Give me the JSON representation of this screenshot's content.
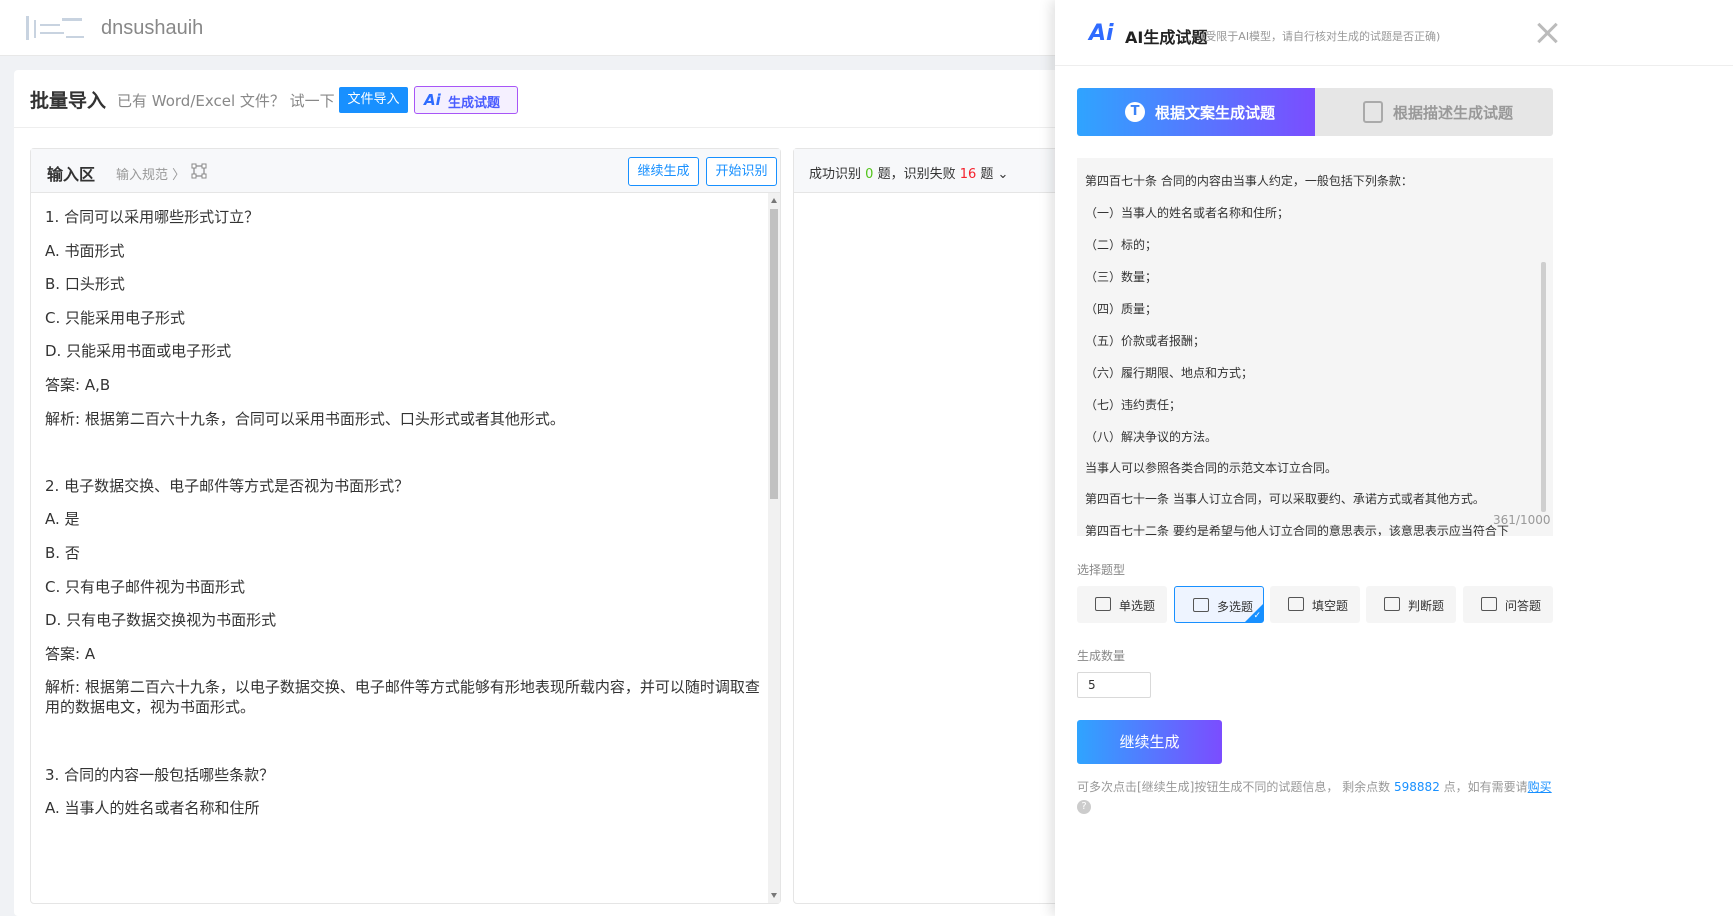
{
  "topbar": {
    "site_name": "dnsushauih"
  },
  "header": {
    "title": "批量导入",
    "desc": "已有 Word/Excel 文件？ 试一下",
    "file_import": "文件导入",
    "ai_mark": "Ai",
    "ai_generate": "生成试题"
  },
  "input_area": {
    "title": "输入区",
    "spec": "输入规范 〉",
    "continue": "继续生成",
    "start": "开始识别",
    "lines": [
      "1. 合同可以采用哪些形式订立？",
      "A. 书面形式",
      "B. 口头形式",
      "C. 只能采用电子形式",
      "D. 只能采用书面或电子形式",
      "答案: A,B",
      "解析: 根据第二百六十九条，合同可以采用书面形式、口头形式或者其他形式。",
      "",
      "2. 电子数据交换、电子邮件等方式是否视为书面形式？",
      "A. 是",
      "B. 否",
      "C. 只有电子邮件视为书面形式",
      "D. 只有电子数据交换视为书面形式",
      "答案: A",
      "解析: 根据第二百六十九条，以电子数据交换、电子邮件等方式能够有形地表现所载内容，并可以随时调取查用的数据电文，视为书面形式。",
      "",
      "3. 合同的内容一般包括哪些条款？",
      "A. 当事人的姓名或者名称和住所"
    ]
  },
  "result": {
    "prefix": "成功识别",
    "success": "0",
    "mid": "题，识别失败",
    "fail": "16",
    "suffix": "题 ⌄"
  },
  "drawer": {
    "icon": "Ai",
    "title": "AI生成试题",
    "subtitle": "(受限于AI模型，请自行核对生成的试题是否正确)",
    "tab_text": "根据文案生成试题",
    "tab_desc": "根据描述生成试题",
    "text_lines": [
      "第四百七十条    合同的内容由当事人约定，一般包括下列条款：",
      "（一）当事人的姓名或者名称和住所；",
      "（二）标的；",
      "（三）数量；",
      "（四）质量；",
      "（五）价款或者报酬；",
      "（六）履行期限、地点和方式；",
      "（七）违约责任；",
      "（八）解决争议的方法。",
      "当事人可以参照各类合同的示范文本订立合同。",
      "第四百七十一条    当事人订立合同，可以采取要约、承诺方式或者其他方式。",
      "第四百七十二条    要约是希望与他人订立合同的意思表示，该意思表示应当符合下"
    ],
    "counter": "361/1000",
    "qtype_label": "选择题型",
    "qtypes": [
      "单选题",
      "多选题",
      "填空题",
      "判断题",
      "问答题"
    ],
    "count_label": "生成数量",
    "count_value": "5",
    "generate": "继续生成",
    "note_prefix": "可多次点击[继续生成]按钮生成不同的试题信息，  剩余点数",
    "points": "598882",
    "note_mid": "点，如有需要请",
    "buy": "购买"
  }
}
